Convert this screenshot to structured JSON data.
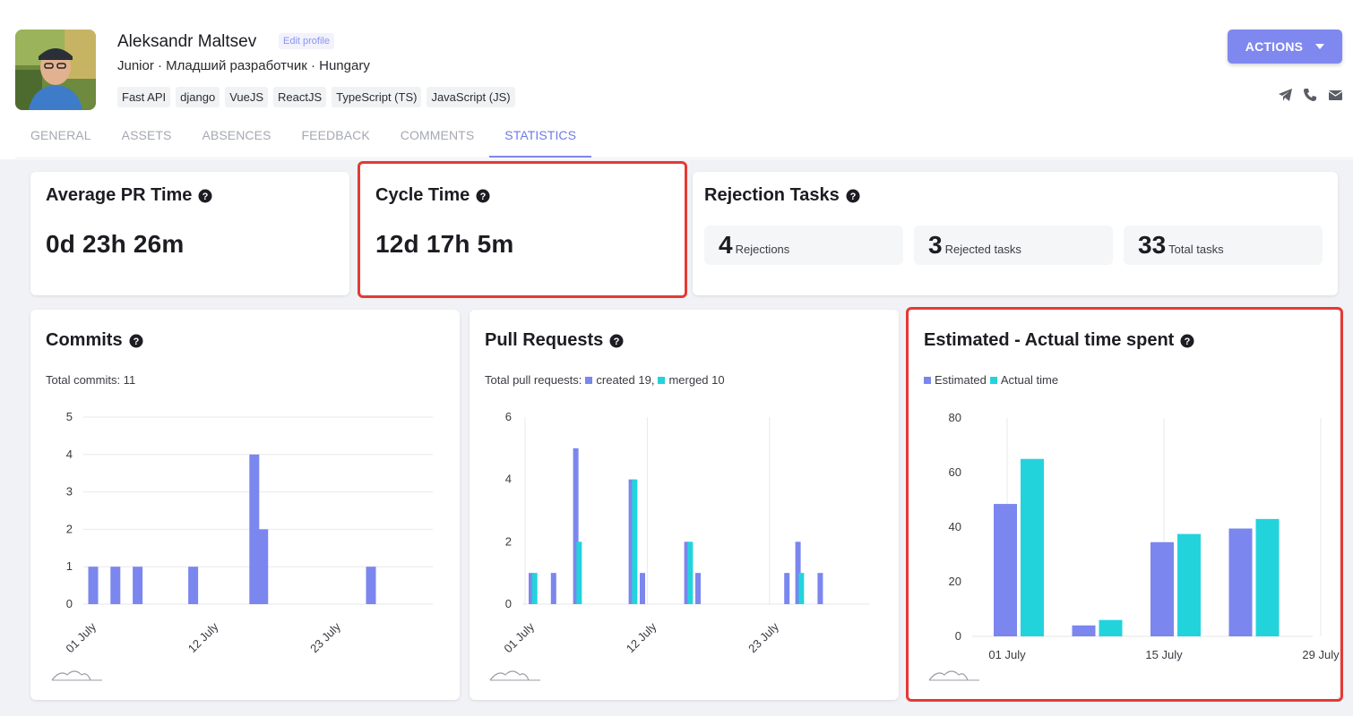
{
  "profile": {
    "name": "Aleksandr Maltsev",
    "edit_label": "Edit profile",
    "subtitle": "Junior · Младший разработчик · Hungary",
    "tags": [
      "Fast API",
      "django",
      "VueJS",
      "ReactJS",
      "TypeScript (TS)",
      "JavaScript (JS)"
    ],
    "actions_label": "ACTIONS"
  },
  "tabs": [
    "GENERAL",
    "ASSETS",
    "ABSENCES",
    "FEEDBACK",
    "COMMENTS",
    "STATISTICS"
  ],
  "active_tab": "STATISTICS",
  "metrics": {
    "avg_pr": {
      "title": "Average PR Time",
      "value": "0d 23h 26m"
    },
    "cycle": {
      "title": "Cycle Time",
      "value": "12d 17h 5m"
    },
    "rejection": {
      "title": "Rejection Tasks",
      "stats": [
        {
          "value": "4",
          "label": "Rejections"
        },
        {
          "value": "3",
          "label": "Rejected tasks"
        },
        {
          "value": "33",
          "label": "Total tasks"
        }
      ]
    }
  },
  "colors": {
    "accent": "#7f88ef",
    "blue_series": "#7b86ee",
    "cyan_series": "#23d3dc",
    "highlight": "#e53935"
  },
  "icons": [
    "avatar-photo",
    "chevron-down-icon",
    "telegram-icon",
    "phone-icon",
    "mail-icon",
    "help-icon",
    "zoom-reset-icon"
  ],
  "charts": {
    "commits": {
      "title": "Commits",
      "subtitle": "Total commits: 11"
    },
    "pull_requests": {
      "title": "Pull Requests",
      "subtitle_prefix": "Total pull requests:",
      "created_label": "created 19,",
      "merged_label": "merged 10"
    },
    "est_actual": {
      "title": "Estimated - Actual time spent",
      "estimated_label": "Estimated",
      "actual_label": "Actual time"
    }
  },
  "chart_data": [
    {
      "id": "commits",
      "type": "bar",
      "title": "Commits",
      "x_unit": "day of July",
      "x_ticks": [
        "01 July",
        "12 July",
        "23 July"
      ],
      "x_tick_days": [
        1,
        12,
        23
      ],
      "ylim": [
        0,
        5
      ],
      "y_ticks": [
        "0",
        "1",
        "2",
        "3",
        "4",
        "5"
      ],
      "grid": true,
      "series": [
        {
          "points": [
            [
              1,
              1
            ],
            [
              3,
              1
            ],
            [
              5,
              1
            ],
            [
              10,
              1
            ],
            [
              15.5,
              4
            ],
            [
              16.3,
              2
            ],
            [
              26,
              1
            ]
          ]
        }
      ]
    },
    {
      "id": "pull_requests",
      "type": "bar",
      "title": "Pull Requests",
      "x_unit": "day of July",
      "x_ticks": [
        "01 July",
        "12 July",
        "23 July"
      ],
      "x_tick_days": [
        1,
        12,
        23
      ],
      "ylim": [
        0,
        6
      ],
      "y_ticks": [
        "0",
        "2",
        "4",
        "6"
      ],
      "grid": true,
      "series": [
        {
          "name": "created",
          "points": [
            [
              1,
              1
            ],
            [
              3,
              1
            ],
            [
              5,
              5
            ],
            [
              10,
              4
            ],
            [
              11,
              1
            ],
            [
              15,
              2
            ],
            [
              16,
              1
            ],
            [
              24,
              1
            ],
            [
              25,
              2
            ],
            [
              27,
              1
            ]
          ]
        },
        {
          "name": "merged",
          "points": [
            [
              1.3,
              1
            ],
            [
              5.3,
              2
            ],
            [
              10.3,
              4
            ],
            [
              15.3,
              2
            ],
            [
              25.3,
              1
            ]
          ]
        }
      ]
    },
    {
      "id": "est_actual",
      "type": "bar",
      "title": "Estimated - Actual time spent",
      "categories": [
        "01 July",
        "",
        "15 July",
        "",
        "29 July"
      ],
      "ylim": [
        0,
        80
      ],
      "y_ticks": [
        "0",
        "20",
        "40",
        "60",
        "80"
      ],
      "grid": true,
      "series": [
        {
          "name": "Estimated",
          "values": [
            48.5,
            4,
            34.5,
            39.5,
            null
          ]
        },
        {
          "name": "Actual time",
          "values": [
            65,
            6,
            37.5,
            43,
            null
          ]
        }
      ]
    }
  ]
}
